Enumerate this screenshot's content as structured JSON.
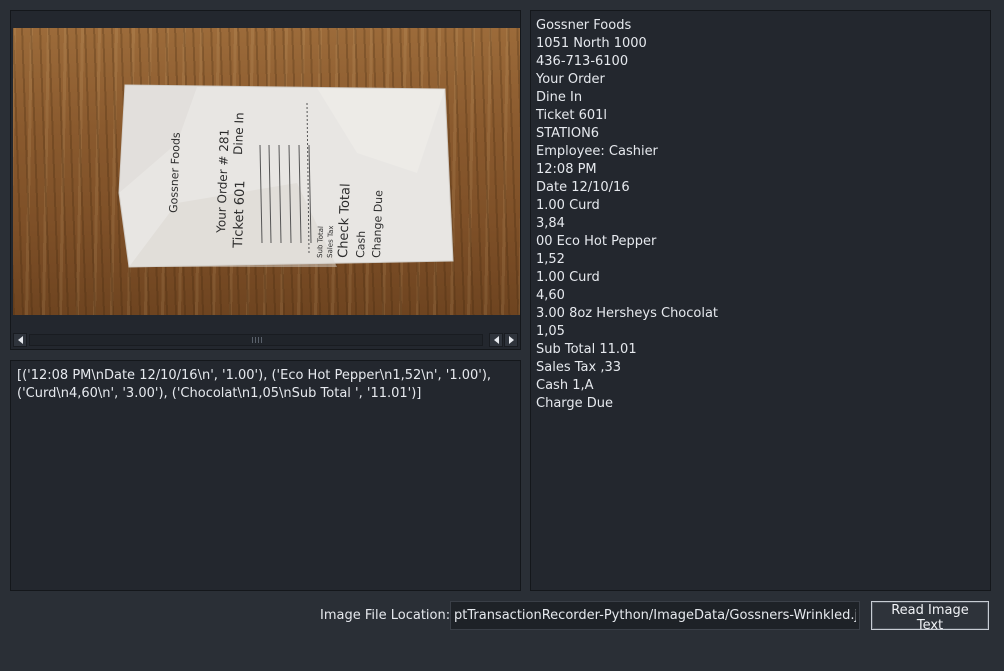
{
  "image_viewer": {
    "receipt_photo_lines": [
      "Gossner Foods",
      "Your Order # 281",
      "Ticket 601",
      "Dine In",
      "Sub Total",
      "Sales Tax",
      "Check Total",
      "Cash",
      "Change Due"
    ]
  },
  "parsed_output": {
    "text": "[('12:08 PM\\nDate 12/10/16\\n', '1.00'), ('Eco Hot Pepper\\n1,52\\n', '1.00'), ('Curd\\n4,60\\n', '3.00'), ('Chocolat\\n1,05\\nSub Total ', '11.01')]"
  },
  "ocr_text": {
    "lines": [
      "Gossner Foods",
      "1051 North 1000",
      "436-713-6100",
      "Your Order",
      "Dine In",
      "Ticket 601l",
      "STATION6",
      "Employee: Cashier",
      "12:08 PM",
      "Date 12/10/16",
      "1.00 Curd",
      "3,84",
      "00 Eco Hot Pepper",
      "1,52",
      "1.00 Curd",
      "4,60",
      "3.00 8oz Hersheys Chocolat",
      "1,05",
      "Sub Total 11.01",
      "Sales Tax ,33",
      "Cash 1,A",
      "Charge Due"
    ]
  },
  "file_bar": {
    "label": "Image File Location:",
    "value": "ptTransactionRecorder-Python/ImageData/Gossners-Wrinkled.jpg",
    "read_button": "Read Image Text"
  },
  "icons": {
    "scroll_left": "arrow-left-icon",
    "scroll_right": "arrow-right-icon"
  },
  "colors": {
    "background": "#2a2f36",
    "pane": "#23272e",
    "text": "#e6e9ee"
  }
}
